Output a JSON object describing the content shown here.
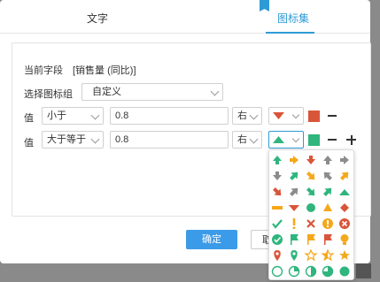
{
  "tabs": {
    "text_label": "文字",
    "icons_label": "图标集"
  },
  "current_field": {
    "label": "当前字段",
    "value": "[销售量 (同比)]"
  },
  "icon_group": {
    "label": "选择图标组",
    "value": "自定义"
  },
  "rules": [
    {
      "value_label": "值",
      "operator": "小于",
      "threshold": "0.8",
      "side": "右",
      "icon": "triangle-down-red-icon",
      "color": "#d9553a"
    },
    {
      "value_label": "值",
      "operator": "大于等于",
      "threshold": "0.8",
      "side": "右",
      "icon": "triangle-up-green-icon",
      "color": "#2fb57d"
    }
  ],
  "buttons": {
    "ok": "确定",
    "cancel": "取"
  },
  "icon_palette": {
    "colors": {
      "green": "#2fb57d",
      "orange": "#f4a81c",
      "red": "#d9553a",
      "gray": "#8c8c8c",
      "yellow": "#f5c518"
    },
    "icons": [
      "arrow-up-green-icon",
      "arrow-right-orange-icon",
      "arrow-down-red-icon",
      "arrow-up-gray-icon",
      "arrow-right-gray-icon",
      "arrow-down-gray-icon",
      "arrow-up-right-green-icon",
      "arrow-down-right-orange-icon",
      "arrow-up-left-gray-icon",
      "arrow-up-right-orange-icon",
      "arrow-down-right-red-icon",
      "arrow-up-right-gray-icon",
      "arrow-down-right-green-icon",
      "arrow-up-right-green-icon",
      "triangle-up-green-icon",
      "dash-orange-icon",
      "triangle-down-red-icon",
      "circle-green-icon",
      "triangle-orange-icon",
      "diamond-red-icon",
      "check-green-icon",
      "exclamation-orange-icon",
      "cross-red-icon",
      "exclamation-circle-orange-icon",
      "cross-circle-red-icon",
      "check-circle-green-icon",
      "flag-green-icon",
      "flag-orange-icon",
      "flag-red-icon",
      "bulb-orange-icon",
      "pin-red-icon",
      "pin-green-icon",
      "star-outline-orange-icon",
      "star-half-orange-icon",
      "star-orange-icon",
      "circle-empty-green-icon",
      "circle-quarter-green-icon",
      "circle-half-green-icon",
      "circle-full-green-icon"
    ]
  }
}
